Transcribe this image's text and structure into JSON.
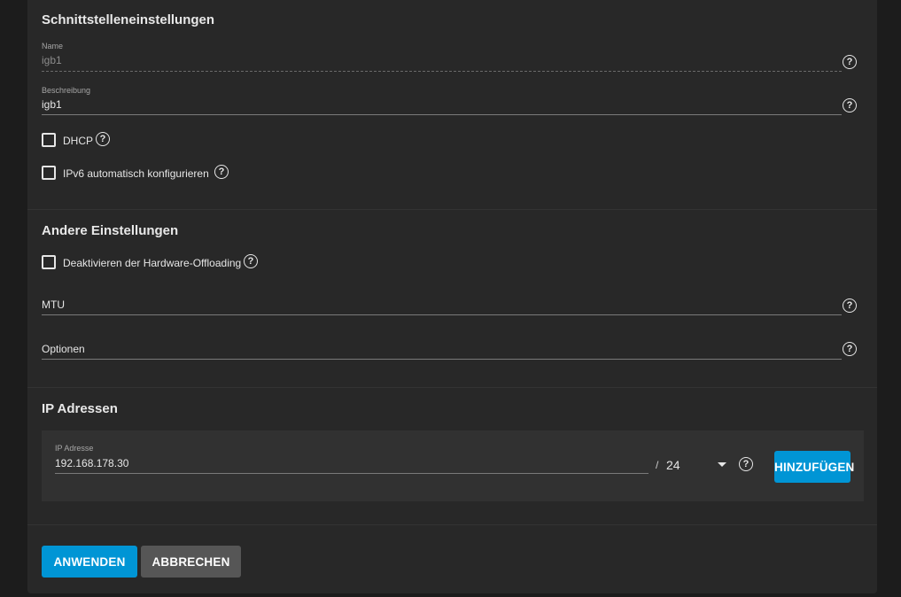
{
  "interface_settings": {
    "title": "Schnittstelleneinstellungen",
    "name": {
      "label": "Name",
      "value": "igb1"
    },
    "description": {
      "label": "Beschreibung",
      "value": "igb1"
    },
    "dhcp": {
      "label": "DHCP",
      "checked": false
    },
    "ipv6_auto": {
      "label": "IPv6 automatisch konfigurieren",
      "checked": false
    }
  },
  "other_settings": {
    "title": "Andere Einstellungen",
    "disable_hw_offloading": {
      "label": "Deaktivieren der Hardware-Offloading",
      "checked": false
    },
    "mtu": {
      "placeholder": "MTU",
      "value": ""
    },
    "options": {
      "placeholder": "Optionen",
      "value": ""
    }
  },
  "ip_addresses": {
    "title": "IP Adressen",
    "entry": {
      "label": "IP Adresse",
      "value": "192.168.178.30",
      "separator": "/",
      "netmask": "24"
    },
    "add_button": "HINZUFÜGEN"
  },
  "actions": {
    "apply": "ANWENDEN",
    "cancel": "ABBRECHEN"
  },
  "icons": {
    "help": "?"
  },
  "colors": {
    "accent": "#0095d5",
    "secondary_button": "#565656",
    "card": "#282828",
    "background": "#1c1c1c"
  }
}
